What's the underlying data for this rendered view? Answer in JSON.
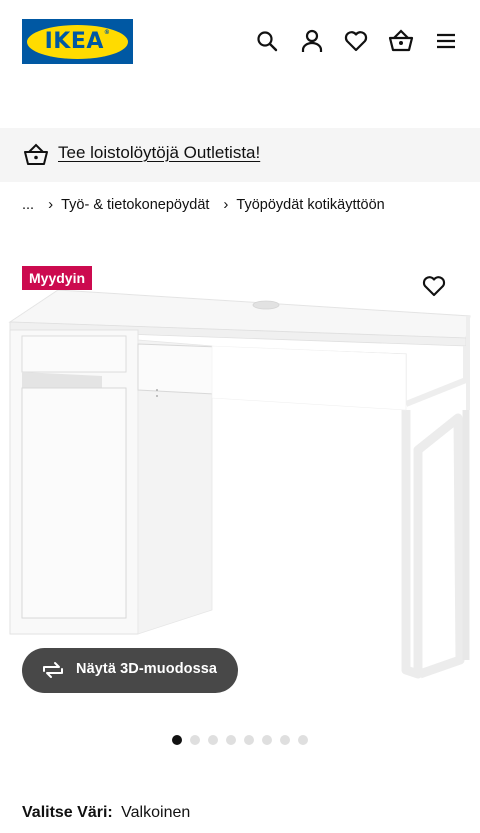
{
  "brand": {
    "logo_text": "IKEA",
    "logo_blue": "#0058a3",
    "logo_yellow": "#ffdb00"
  },
  "header": {
    "icons": [
      "search-icon",
      "account-icon",
      "heart-icon",
      "basket-icon",
      "menu-icon"
    ]
  },
  "banner": {
    "text": "Tee loistolöytöjä Outletista!",
    "icon": "basket-icon"
  },
  "breadcrumb": {
    "ellipsis": "...",
    "items": [
      "Työ- & tietokonepöydät",
      "Työpöydät kotikäyttöön"
    ]
  },
  "product": {
    "badge": "Myydyin",
    "badge_color": "#cc0a4f",
    "image": "white-desk-with-drawers-and-cabinet",
    "view_3d_label": "Näytä 3D-muodossa",
    "gallery": {
      "count": 8,
      "active_index": 0
    }
  },
  "color_selector": {
    "label": "Valitse Väri:",
    "value": "Valkoinen"
  }
}
